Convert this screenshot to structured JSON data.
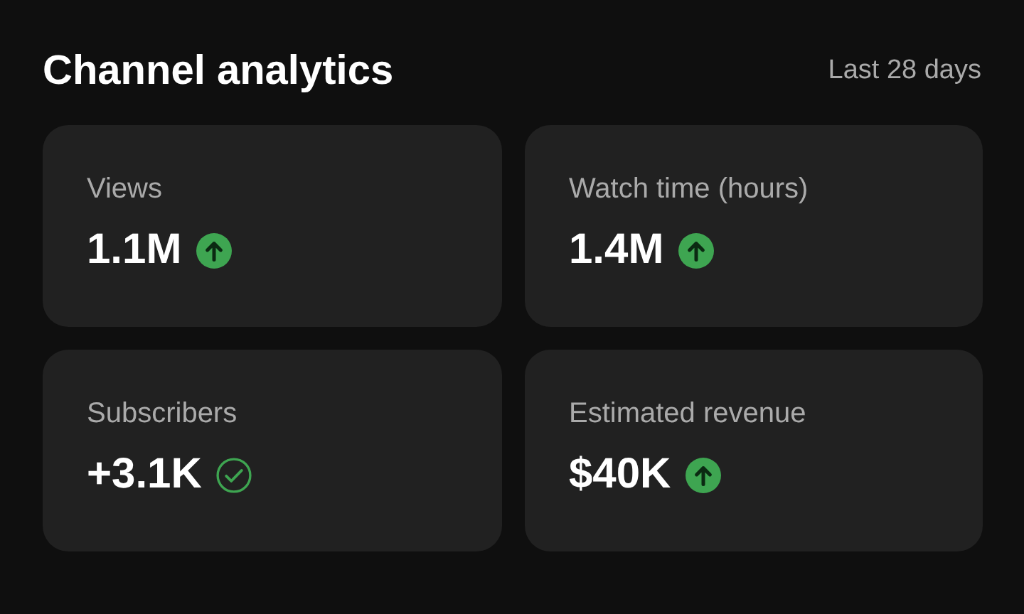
{
  "header": {
    "title": "Channel analytics",
    "period": "Last 28 days"
  },
  "metrics": [
    {
      "label": "Views",
      "value": "1.1M",
      "kind": "rising"
    },
    {
      "label": "Watch time (hours)",
      "value": "1.4M",
      "kind": "rising"
    },
    {
      "label": "Subscribers",
      "value": "+3.1K",
      "kind": "verified"
    },
    {
      "label": "Estimated revenue",
      "value": "$40K",
      "kind": "rising"
    }
  ]
}
